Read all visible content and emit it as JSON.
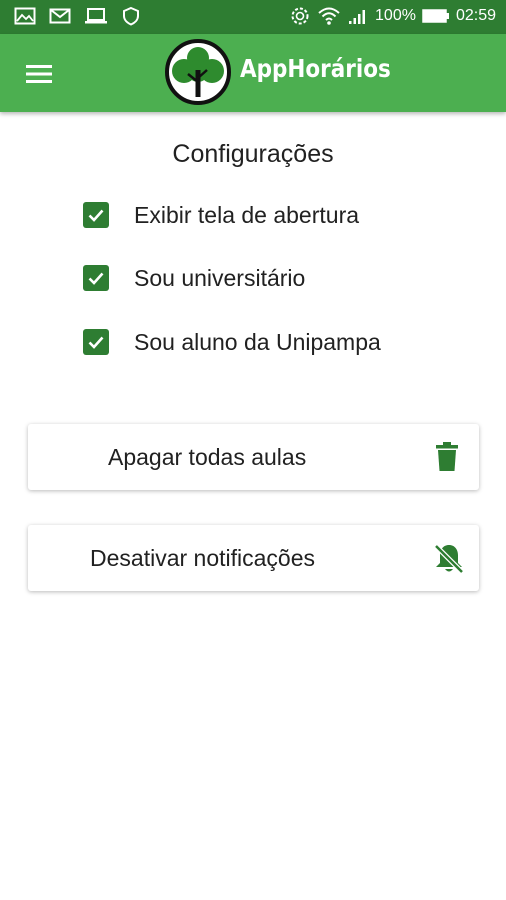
{
  "status_bar": {
    "battery_percent": "100%",
    "time": "02:59",
    "left_icons": [
      "image-icon",
      "mail-icon",
      "laptop-icon",
      "shield-icon"
    ],
    "right_icons": [
      "sync-icon",
      "wifi-icon",
      "signal-icon",
      "battery-icon"
    ]
  },
  "app_bar": {
    "title": "AppHorários",
    "menu_icon": "hamburger-menu-icon",
    "logo_icon": "tree-logo-icon"
  },
  "settings": {
    "title": "Configurações",
    "options": [
      {
        "label": "Exibir tela de abertura",
        "checked": true
      },
      {
        "label": "Sou universitário",
        "checked": true
      },
      {
        "label": "Sou aluno da Unipampa",
        "checked": true
      }
    ]
  },
  "actions": {
    "delete_all": {
      "label": "Apagar todas aulas",
      "icon": "trash-icon"
    },
    "disable_notifications": {
      "label": "Desativar notificações",
      "icon": "bell-off-icon"
    }
  },
  "colors": {
    "status_bar": "#2e7d32",
    "app_bar": "#4caf50",
    "accent": "#2e7d32",
    "text": "#212121"
  }
}
